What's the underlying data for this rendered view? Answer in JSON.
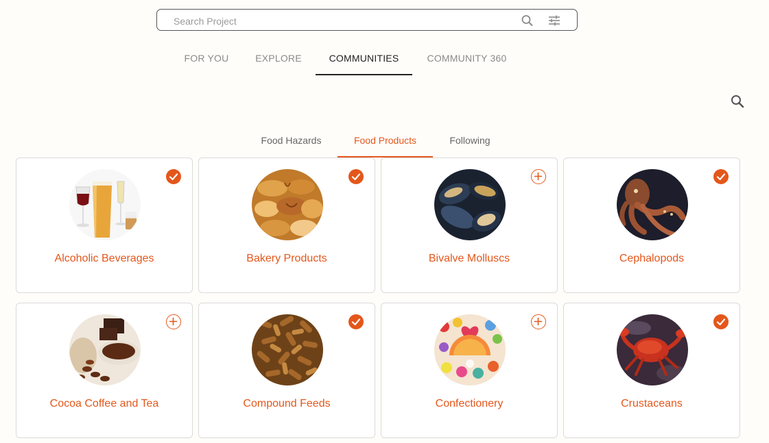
{
  "search": {
    "placeholder": "Search Project"
  },
  "main_tabs": [
    {
      "label": "FOR YOU",
      "active": false
    },
    {
      "label": "EXPLORE",
      "active": false
    },
    {
      "label": "COMMUNITIES",
      "active": true
    },
    {
      "label": "COMMUNITY 360",
      "active": false
    }
  ],
  "sub_tabs": [
    {
      "label": "Food Hazards",
      "active": false
    },
    {
      "label": "Food Products",
      "active": true
    },
    {
      "label": "Following",
      "active": false
    }
  ],
  "communities": [
    {
      "label": "Alcoholic Beverages",
      "followed": true
    },
    {
      "label": "Bakery Products",
      "followed": true
    },
    {
      "label": "Bivalve Molluscs",
      "followed": false
    },
    {
      "label": "Cephalopods",
      "followed": true
    },
    {
      "label": "Cocoa Coffee and Tea",
      "followed": false
    },
    {
      "label": "Compound Feeds",
      "followed": true
    },
    {
      "label": "Confectionery",
      "followed": false
    },
    {
      "label": "Crustaceans",
      "followed": true
    }
  ],
  "colors": {
    "accent": "#e4571b",
    "active_tab": "#222222",
    "inactive_tab": "#8a8a8a"
  }
}
